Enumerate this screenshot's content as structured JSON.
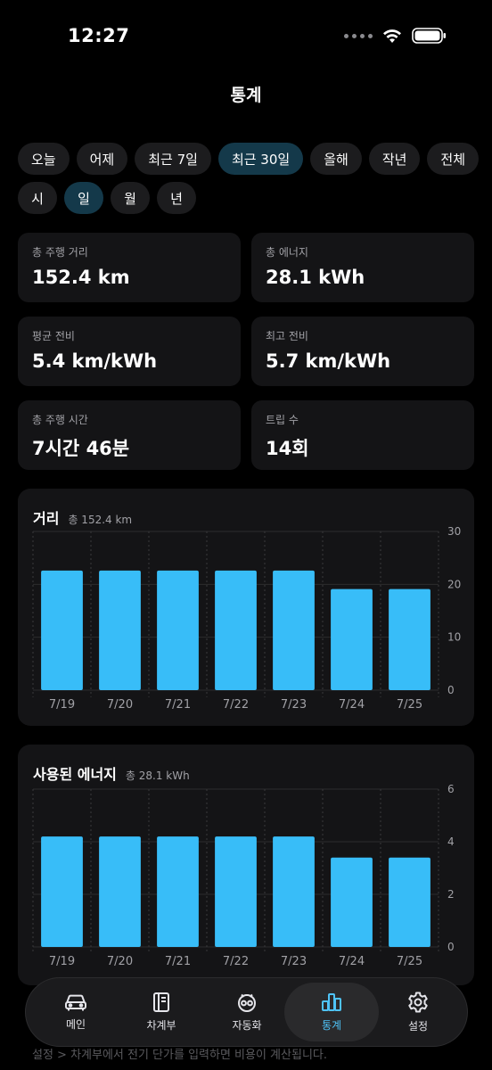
{
  "status": {
    "time": "12:27"
  },
  "header": {
    "title": "통계"
  },
  "range_chips": [
    {
      "label": "오늘"
    },
    {
      "label": "어제"
    },
    {
      "label": "최근 7일"
    },
    {
      "label": "최근 30일",
      "active": true
    },
    {
      "label": "올해"
    },
    {
      "label": "작년"
    },
    {
      "label": "전체"
    }
  ],
  "unit_chips": [
    {
      "label": "시"
    },
    {
      "label": "일",
      "active": true
    },
    {
      "label": "월"
    },
    {
      "label": "년"
    }
  ],
  "stats": [
    {
      "label": "총 주행 거리",
      "value": "152.4 km"
    },
    {
      "label": "총 에너지",
      "value": "28.1 kWh"
    },
    {
      "label": "평균 전비",
      "value": "5.4 km/kWh"
    },
    {
      "label": "최고 전비",
      "value": "5.7 km/kWh"
    },
    {
      "label": "총 주행 시간",
      "value": "7시간 46분"
    },
    {
      "label": "트립 수",
      "value": "14회"
    }
  ],
  "chart_data": [
    {
      "type": "bar",
      "title": "거리",
      "subtitle": "총 152.4 km",
      "categories": [
        "7/19",
        "7/20",
        "7/21",
        "7/22",
        "7/23",
        "7/24",
        "7/25"
      ],
      "values": [
        22.6,
        22.6,
        22.6,
        22.6,
        22.6,
        19.1,
        19.1
      ],
      "ylim": [
        0,
        30
      ],
      "yticks": [
        0,
        10,
        20,
        30
      ],
      "bar_color": "#38bdf8",
      "grid": true,
      "y_axis_side": "right"
    },
    {
      "type": "bar",
      "title": "사용된 에너지",
      "subtitle": "총 28.1 kWh",
      "categories": [
        "7/19",
        "7/20",
        "7/21",
        "7/22",
        "7/23",
        "7/24",
        "7/25"
      ],
      "values": [
        4.2,
        4.2,
        4.2,
        4.2,
        4.2,
        3.4,
        3.4
      ],
      "ylim": [
        0,
        6
      ],
      "yticks": [
        0,
        2,
        4,
        6
      ],
      "bar_color": "#38bdf8",
      "grid": true,
      "y_axis_side": "right"
    }
  ],
  "tabs": [
    {
      "label": "메인",
      "icon": "car-icon"
    },
    {
      "label": "차계부",
      "icon": "ledger-icon"
    },
    {
      "label": "자동화",
      "icon": "automation-icon"
    },
    {
      "label": "통계",
      "icon": "stats-icon",
      "active": true
    },
    {
      "label": "설정",
      "icon": "gear-icon"
    }
  ],
  "bottom_hint": "설정 > 차계부에서 전기 단가를 입력하면 비용이 계산됩니다.",
  "colors": {
    "accent": "#38bdf8",
    "chip_active": "#14394a",
    "card": "#141416"
  }
}
